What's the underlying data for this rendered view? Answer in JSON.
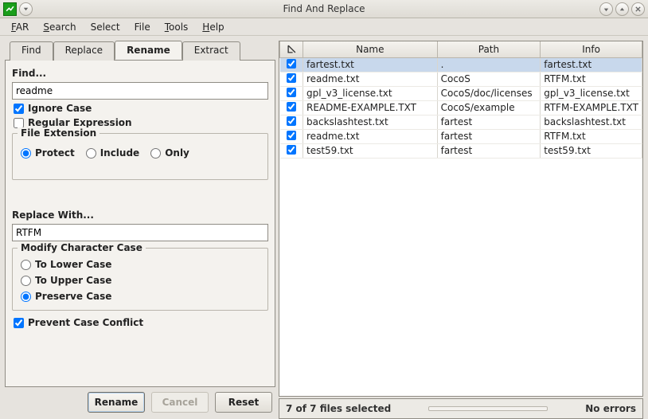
{
  "window": {
    "title": "Find And Replace"
  },
  "menu": {
    "items": [
      {
        "label": "FAR",
        "accel": "F"
      },
      {
        "label": "Search",
        "accel": "S"
      },
      {
        "label": "Select",
        "accel": ""
      },
      {
        "label": "File",
        "accel": ""
      },
      {
        "label": "Tools",
        "accel": "T"
      },
      {
        "label": "Help",
        "accel": "H"
      }
    ]
  },
  "tabs": {
    "items": [
      "Find",
      "Replace",
      "Rename",
      "Extract"
    ],
    "active_index": 2
  },
  "rename": {
    "find_label": "Find...",
    "find_value": "readme",
    "ignore_case_label": "Ignore Case",
    "ignore_case_checked": true,
    "regex_label": "Regular Expression",
    "regex_checked": false,
    "file_ext_legend": "File Extension",
    "file_ext_options": [
      "Protect",
      "Include",
      "Only"
    ],
    "file_ext_selected": "Protect",
    "replace_with_label": "Replace With...",
    "replace_with_value": "RTFM",
    "mod_case_legend": "Modify Character Case",
    "mod_case_options": [
      "To Lower Case",
      "To Upper Case",
      "Preserve Case"
    ],
    "mod_case_selected": "Preserve Case",
    "prevent_conflict_label": "Prevent Case Conflict",
    "prevent_conflict_checked": true,
    "buttons": {
      "rename": "Rename",
      "cancel": "Cancel",
      "reset": "Reset"
    }
  },
  "table": {
    "headers": [
      "Name",
      "Path",
      "Info"
    ],
    "rows": [
      {
        "checked": true,
        "selected": true,
        "name": "fartest.txt",
        "path": ".",
        "info": "fartest.txt"
      },
      {
        "checked": true,
        "selected": false,
        "name": "readme.txt",
        "path": "CocoS",
        "info": "RTFM.txt"
      },
      {
        "checked": true,
        "selected": false,
        "name": "gpl_v3_license.txt",
        "path": "CocoS/doc/licenses",
        "info": "gpl_v3_license.txt"
      },
      {
        "checked": true,
        "selected": false,
        "name": "README-EXAMPLE.TXT",
        "path": "CocoS/example",
        "info": "RTFM-EXAMPLE.TXT"
      },
      {
        "checked": true,
        "selected": false,
        "name": "backslashtest.txt",
        "path": "fartest",
        "info": "backslashtest.txt"
      },
      {
        "checked": true,
        "selected": false,
        "name": "readme.txt",
        "path": "fartest",
        "info": "RTFM.txt"
      },
      {
        "checked": true,
        "selected": false,
        "name": "test59.txt",
        "path": "fartest",
        "info": "test59.txt"
      }
    ]
  },
  "status": {
    "selection": "7 of 7 files selected",
    "errors": "No errors"
  }
}
